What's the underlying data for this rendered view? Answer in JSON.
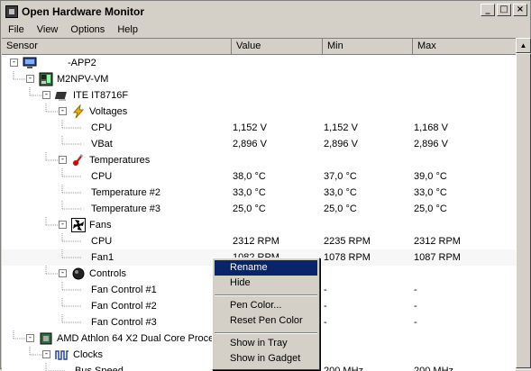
{
  "window": {
    "title": "Open Hardware Monitor",
    "buttons": {
      "minimize": "_",
      "maximize": "□",
      "close": "×"
    }
  },
  "menu": [
    "File",
    "View",
    "Options",
    "Help"
  ],
  "columns": {
    "sensor": "Sensor",
    "value": "Value",
    "min": "Min",
    "max": "Max"
  },
  "rows": [
    {
      "label": "-APP2",
      "value": "",
      "min": "",
      "max": "",
      "icon": "computer-icon",
      "exp": "-"
    },
    {
      "label": "M2NPV-VM",
      "value": "",
      "min": "",
      "max": "",
      "icon": "motherboard-icon",
      "exp": "-"
    },
    {
      "label": "ITE IT8716F",
      "value": "",
      "min": "",
      "max": "",
      "icon": "chip-icon",
      "exp": "-"
    },
    {
      "label": "Voltages",
      "value": "",
      "min": "",
      "max": "",
      "icon": "lightning-icon",
      "exp": "-"
    },
    {
      "label": "CPU",
      "value": "1,152 V",
      "min": "1,152 V",
      "max": "1,168 V",
      "icon": "",
      "exp": ""
    },
    {
      "label": "VBat",
      "value": "2,896 V",
      "min": "2,896 V",
      "max": "2,896 V",
      "icon": "",
      "exp": ""
    },
    {
      "label": "Temperatures",
      "value": "",
      "min": "",
      "max": "",
      "icon": "thermometer-icon",
      "exp": "-"
    },
    {
      "label": "CPU",
      "value": "38,0 °C",
      "min": "37,0 °C",
      "max": "39,0 °C",
      "icon": "",
      "exp": ""
    },
    {
      "label": "Temperature #2",
      "value": "33,0 °C",
      "min": "33,0 °C",
      "max": "33,0 °C",
      "icon": "",
      "exp": ""
    },
    {
      "label": "Temperature #3",
      "value": "25,0 °C",
      "min": "25,0 °C",
      "max": "25,0 °C",
      "icon": "",
      "exp": ""
    },
    {
      "label": "Fans",
      "value": "",
      "min": "",
      "max": "",
      "icon": "fan-icon",
      "exp": "-"
    },
    {
      "label": "CPU",
      "value": "2312 RPM",
      "min": "2235 RPM",
      "max": "2312 RPM",
      "icon": "",
      "exp": ""
    },
    {
      "label": "Fan1",
      "value": "1082 RPM",
      "min": "1078 RPM",
      "max": "1087 RPM",
      "icon": "",
      "exp": ""
    },
    {
      "label": "Controls",
      "value": "",
      "min": "",
      "max": "",
      "icon": "knob-icon",
      "exp": "-"
    },
    {
      "label": "Fan Control #1",
      "value": "",
      "min": "-",
      "max": "-",
      "icon": "",
      "exp": ""
    },
    {
      "label": "Fan Control #2",
      "value": "",
      "min": "-",
      "max": "-",
      "icon": "",
      "exp": ""
    },
    {
      "label": "Fan Control #3",
      "value": "",
      "min": "-",
      "max": "-",
      "icon": "",
      "exp": ""
    },
    {
      "label": "AMD Athlon 64 X2 Dual Core Proce",
      "value": "",
      "min": "",
      "max": "",
      "icon": "cpu-icon",
      "exp": "-"
    },
    {
      "label": "Clocks",
      "value": "",
      "min": "",
      "max": "",
      "icon": "clock-icon",
      "exp": "-"
    },
    {
      "label": "Bus Speed",
      "value": "",
      "min": "200 MHz",
      "max": "200 MHz",
      "icon": "",
      "exp": ""
    }
  ],
  "context_menu": {
    "items": [
      "Rename",
      "Hide",
      "Pen Color...",
      "Reset Pen Color",
      "Show in Tray",
      "Show in Gadget"
    ]
  }
}
